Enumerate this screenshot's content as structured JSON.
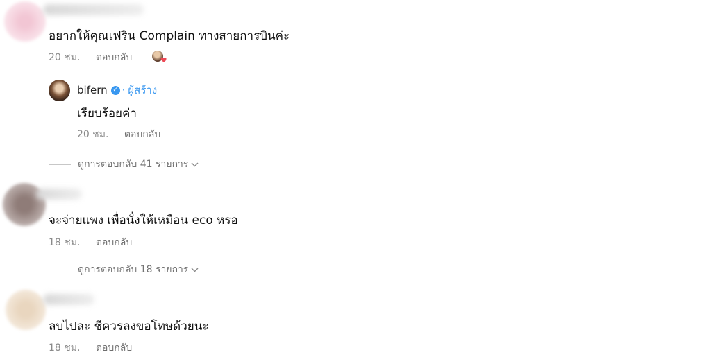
{
  "colors": {
    "heart": "#ed4956",
    "verified": "#3897f0"
  },
  "comments": [
    {
      "text": "อยากให้คุณเฟริน Complain ทางสายการบินค่ะ",
      "time": "20 ชม.",
      "reply_label": "ตอบกลับ",
      "liked_by_creator": true,
      "reply": {
        "username": "bifern",
        "separator": "·",
        "creator_label": "ผู้สร้าง",
        "text": "เรียบร้อยค่า",
        "time": "20 ชม.",
        "reply_label": "ตอบกลับ"
      },
      "view_replies": "ดูการตอบกลับ 41 รายการ"
    },
    {
      "text": "จะจ่ายแพง เพื่อนั่งให้เหมือน eco หรอ",
      "time": "18 ชม.",
      "reply_label": "ตอบกลับ",
      "view_replies": "ดูการตอบกลับ 18 รายการ"
    },
    {
      "text": "ลบไปละ ชีควรลงขอโทษด้วยนะ",
      "time": "18 ชม.",
      "reply_label": "ตอบกลับ"
    }
  ],
  "icons": {
    "verified": "verified-badge-icon",
    "chevron": "chevron-down-icon",
    "heart": "heart-icon"
  }
}
